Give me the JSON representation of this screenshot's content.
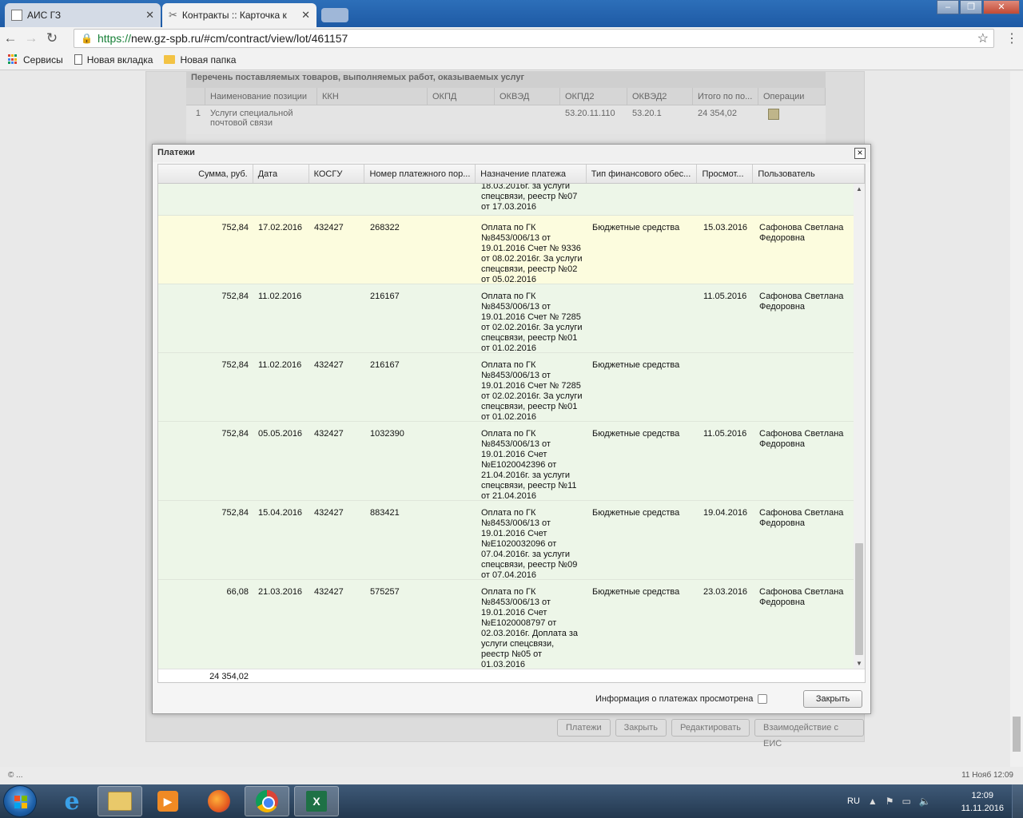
{
  "browser": {
    "tabs": [
      {
        "title": "АИС ГЗ",
        "active": false
      },
      {
        "title": "Контракты :: Карточка к",
        "active": true
      }
    ],
    "url_scheme": "https://",
    "url_rest": "new.gz-spb.ru/#cm/contract/view/lot/461157",
    "bookmarks": [
      "Сервисы",
      "Новая вкладка",
      "Новая папка"
    ]
  },
  "items_panel": {
    "title": "Перечень поставляемых товаров, выполняемых работ, оказываемых услуг",
    "columns": [
      "Наименование позиции",
      "ККН",
      "ОКПД",
      "ОКВЭД",
      "ОКПД2",
      "ОКВЭД2",
      "Итого по по...",
      "Операции"
    ],
    "row": {
      "num": "1",
      "name": "Услуги специальной почтовой связи",
      "okpd2": "53.20.11.110",
      "okved2": "53.20.1",
      "total": "24 354,02"
    }
  },
  "modal": {
    "title": "Платежи",
    "columns": [
      "Сумма, руб.",
      "Дата",
      "КОСГУ",
      "Номер платежного пор...",
      "Назначение платежа",
      "Тип финансового обес...",
      "Просмот...",
      "Пользователь"
    ],
    "partial_row_purpose": "18.03.2016г. за услуги спецсвязи, реестр №07 от 17.03.2016",
    "rows": [
      {
        "sum": "752,84",
        "date": "17.02.2016",
        "kosgu": "432427",
        "number": "268322",
        "purpose": "Оплата по ГК №8453/006/13 от 19.01.2016 Счет № 9336 от 08.02.2016г. За услуги спецсвязи, реестр №02 от 05.02.2016",
        "type": "Бюджетные средства",
        "viewed": "15.03.2016",
        "user": "Сафонова Светлана Федоровна",
        "selected": true
      },
      {
        "sum": "752,84",
        "date": "11.02.2016",
        "kosgu": "",
        "number": "216167",
        "purpose": "Оплата по ГК №8453/006/13 от 19.01.2016 Счет № 7285 от 02.02.2016г. За услуги спецсвязи, реестр №01 от 01.02.2016",
        "type": "",
        "viewed": "11.05.2016",
        "user": "Сафонова Светлана Федоровна",
        "selected": false
      },
      {
        "sum": "752,84",
        "date": "11.02.2016",
        "kosgu": "432427",
        "number": "216167",
        "purpose": "Оплата по ГК №8453/006/13 от 19.01.2016 Счет № 7285 от 02.02.2016г. За услуги спецсвязи, реестр №01 от 01.02.2016",
        "type": "Бюджетные средства",
        "viewed": "",
        "user": "",
        "selected": false
      },
      {
        "sum": "752,84",
        "date": "05.05.2016",
        "kosgu": "432427",
        "number": "1032390",
        "purpose": "Оплата по ГК №8453/006/13 от 19.01.2016 Счет №Е1020042396 от 21.04.2016г. за услуги спецсвязи, реестр №11 от 21.04.2016",
        "type": "Бюджетные средства",
        "viewed": "11.05.2016",
        "user": "Сафонова Светлана Федоровна",
        "selected": false
      },
      {
        "sum": "752,84",
        "date": "15.04.2016",
        "kosgu": "432427",
        "number": "883421",
        "purpose": "Оплата по ГК №8453/006/13 от 19.01.2016 Счет №Е1020032096 от 07.04.2016г. за услуги спецсвязи, реестр №09 от 07.04.2016",
        "type": "Бюджетные средства",
        "viewed": "19.04.2016",
        "user": "Сафонова Светлана Федоровна",
        "selected": false
      },
      {
        "sum": "66,08",
        "date": "21.03.2016",
        "kosgu": "432427",
        "number": "575257",
        "purpose": "Оплата по ГК №8453/006/13 от 19.01.2016 Счет №Е1020008797 от 02.03.2016г. Доплата за услуги спецсвязи, реестр №05 от 01.03.2016",
        "type": "Бюджетные средства",
        "viewed": "23.03.2016",
        "user": "Сафонова Светлана Федоровна",
        "selected": false
      }
    ],
    "total": "24 354,02",
    "viewed_checkbox_label": "Информация о платежах просмотрена",
    "viewed_checked": false,
    "close_label": "Закрыть"
  },
  "page_buttons": [
    "Платежи",
    "Закрыть",
    "Редактировать",
    "Взаимодействие с ЕИС"
  ],
  "statusbar": {
    "left": "© ...",
    "right": "11 Нояб 12:09"
  },
  "taskbar": {
    "lang": "RU",
    "time": "12:09",
    "date": "11.11.2016",
    "apps": [
      "ie-icon",
      "explorer-icon",
      "media-player-icon",
      "firefox-icon",
      "chrome-icon",
      "excel-icon"
    ]
  }
}
